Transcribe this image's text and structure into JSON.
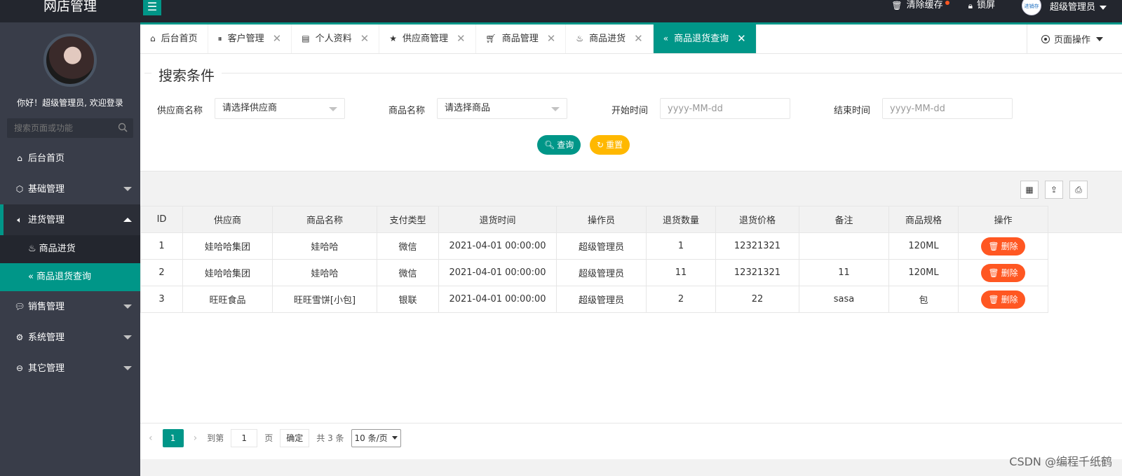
{
  "header": {
    "logo": "网店管理",
    "clear_cache": "清除缓存",
    "lock_screen": "锁屏",
    "avatar_text": "进销存",
    "user_name": "超级管理员"
  },
  "sidebar": {
    "welcome": "你好！超级管理员, 欢迎登录",
    "search_placeholder": "搜索页面或功能",
    "items": [
      {
        "label": "后台首页"
      },
      {
        "label": "基础管理"
      },
      {
        "label": "进货管理"
      },
      {
        "label": "商品进货"
      },
      {
        "label": "商品退货查询"
      },
      {
        "label": "销售管理"
      },
      {
        "label": "系统管理"
      },
      {
        "label": "其它管理"
      }
    ]
  },
  "tabs": [
    {
      "label": "后台首页"
    },
    {
      "label": "客户管理"
    },
    {
      "label": "个人资料"
    },
    {
      "label": "供应商管理"
    },
    {
      "label": "商品管理"
    },
    {
      "label": "商品进货"
    },
    {
      "label": "商品退货查询"
    }
  ],
  "page_ops": "页面操作",
  "search": {
    "legend": "搜索条件",
    "supplier_label": "供应商名称",
    "supplier_value": "请选择供应商",
    "goods_label": "商品名称",
    "goods_value": "请选择商品",
    "start_label": "开始时间",
    "start_placeholder": "yyyy-MM-dd",
    "end_label": "结束时间",
    "end_placeholder": "yyyy-MM-dd",
    "query_btn": "查询",
    "reset_btn": "重置"
  },
  "table": {
    "headers": [
      "ID",
      "供应商",
      "商品名称",
      "支付类型",
      "退货时间",
      "操作员",
      "退货数量",
      "退货价格",
      "备注",
      "商品规格",
      "操作"
    ],
    "rows": [
      [
        "1",
        "娃哈哈集团",
        "娃哈哈",
        "微信",
        "2021-04-01 00:00:00",
        "超级管理员",
        "1",
        "12321321",
        "",
        "120ML"
      ],
      [
        "2",
        "娃哈哈集团",
        "娃哈哈",
        "微信",
        "2021-04-01 00:00:00",
        "超级管理员",
        "11",
        "12321321",
        "11",
        "120ML"
      ],
      [
        "3",
        "旺旺食品",
        "旺旺雪饼[小包]",
        "银联",
        "2021-04-01 00:00:00",
        "超级管理员",
        "2",
        "22",
        "sasa",
        "包"
      ]
    ],
    "delete_label": "删除"
  },
  "pager": {
    "current": "1",
    "goto_label": "到第",
    "goto_value": "1",
    "page_label": "页",
    "ok_label": "确定",
    "total": "共 3 条",
    "page_size": "10 条/页"
  },
  "watermark": "CSDN @编程千纸鹤",
  "colors": {
    "primary": "#009688",
    "sidebar": "#393d49",
    "topbar": "#23262e",
    "warn": "#ffb800",
    "danger": "#ff5722"
  }
}
